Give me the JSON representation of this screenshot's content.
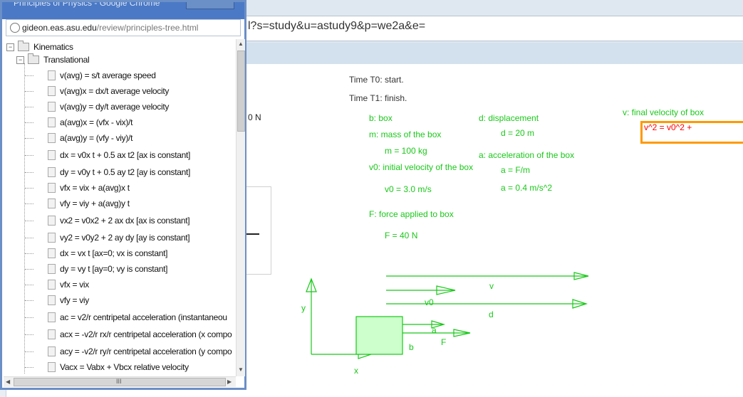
{
  "background": {
    "url_fragment": "l?s=study&u=astudy9&p=we2a&e=",
    "left_fragment": "0 N"
  },
  "content": {
    "time_t0": "Time T0: start.",
    "time_t1": "Time T1: finish.",
    "b_label": "b: box",
    "m_label": "m: mass of the box",
    "m_value": "m = 100 kg",
    "v0_label": "v0: initial velocity of the box",
    "v0_value": "v0 = 3.0 m/s",
    "f_label": "F: force applied to box",
    "f_value": "F = 40 N",
    "d_label": "d: displacement",
    "d_value": "d = 20 m",
    "a_label": "a: acceleration of the box",
    "a_formula": "a = F/m",
    "a_value": "a = 0.4 m/s^2",
    "v_label": "v: final velocity of box",
    "input_value": "v^2 = v0^2 +"
  },
  "diagram": {
    "x_axis": "x",
    "y_axis": "y",
    "box": "b",
    "force": "F",
    "accel": "a",
    "v_arrow": "v",
    "v0_arrow": "v0",
    "d_arrow": "d"
  },
  "popup": {
    "title": "Principles of Physics - Google Chrome",
    "url_host": "gideon.eas.asu.edu",
    "url_path": "/review/principles-tree.html",
    "scroll_h_label": "III",
    "tree": {
      "root": "Kinematics",
      "child": "Translational",
      "items": [
        "v(avg) = s/t average speed",
        "v(avg)x = dx/t average velocity",
        "v(avg)y = dy/t average velocity",
        "a(avg)x = (vfx - vix)/t",
        "a(avg)y = (vfy - viy)/t",
        "dx = v0x t + 0.5 ax t2 [ax is constant]",
        "dy = v0y t + 0.5 ay t2 [ay is constant]",
        "vfx = vix + a(avg)x t",
        "vfy = viy + a(avg)y t",
        "vx2 = v0x2 + 2 ax dx [ax is constant]",
        "vy2 = v0y2 + 2 ay dy [ay is constant]",
        "dx = vx t [ax=0; vx is constant]",
        "dy = vy t [ay=0; vy is constant]",
        "vfx = vix",
        "vfy = viy",
        "ac = v2/r centripetal acceleration (instantaneou",
        "acx = -v2/r rx/r centripetal acceleration (x compo",
        "acy = -v2/r ry/r centripetal acceleration (y compo",
        "Vacx = Vabx + Vbcx relative velocity"
      ]
    }
  }
}
